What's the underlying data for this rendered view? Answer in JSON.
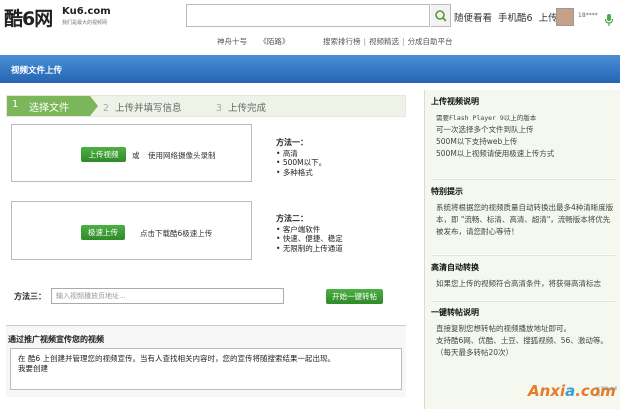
{
  "header": {
    "logo_main": "酷6网",
    "logo_site": "Ku6.com",
    "logo_slogan": "我们是最大的视频网",
    "search_placeholder": "",
    "nav": [
      "随便看看",
      "手机酷6",
      "上传"
    ],
    "username": "18****",
    "hot_links": [
      "神舟十号",
      "《陌路》"
    ],
    "sub_links": [
      "搜索排行榜",
      "视频精选",
      "分成自助平台"
    ]
  },
  "page_title": "视频文件上传",
  "steps": [
    {
      "num": "1",
      "label": "选择文件"
    },
    {
      "num": "2",
      "label": "上传并填写信息"
    },
    {
      "num": "3",
      "label": "上传完成"
    }
  ],
  "method1": {
    "button": "上传视频",
    "or": "或",
    "camera_text": "使用网络摄像头录制",
    "heading": "方法一：",
    "points": [
      "高清",
      "500M以下。",
      "多种格式"
    ]
  },
  "method2": {
    "button": "极速上传",
    "text": "点击下载酷6极速上传",
    "heading": "方法二：",
    "points": [
      "客户端软件",
      "快速、便捷、稳定",
      "无限制的上传通道"
    ]
  },
  "method3": {
    "label": "方法三：",
    "placeholder": "输入视频播放页地址...",
    "button": "开始一键转帖"
  },
  "promo": {
    "title": "通过推广视频宣传您的视频",
    "line1": "在 酷6 上创建并管理您的视频宣传。当有人查找相关内容时，您的宣传将随搜索结果一起出现。",
    "line2": "我要创建"
  },
  "right_panel": {
    "upload_note_title": "上传视频说明",
    "upload_notes": [
      "需要Flash Player 9以上的版本",
      "可一次选择多个文件到队上传",
      "500M以下支持web上传",
      "500M以上视频请使用极速上传方式"
    ],
    "tip_title": "特别提示",
    "tip_text": "系统将根据您的视频质量自动转换出最多4种清晰度版本，即 \"流畅、标清、高清、超清\"，流畅版本将优先被发布，请您耐心等待！",
    "hd_title": "高清自动转换",
    "hd_text": "如果您上传的视频符合高清条件，将获得高清标志",
    "repost_title": "一键转帖说明",
    "repost_text": [
      "直接复制您想转帖的视频播放地址即可。",
      "支持酷6网、优酷、土豆、搜狐视频、56、激动等。",
      "（每天最多转帖20次）"
    ]
  },
  "watermark": {
    "text_a": "Anxi",
    "text_b": "a",
    "text_c": ".com",
    "sub": "安下载·安卓网"
  }
}
